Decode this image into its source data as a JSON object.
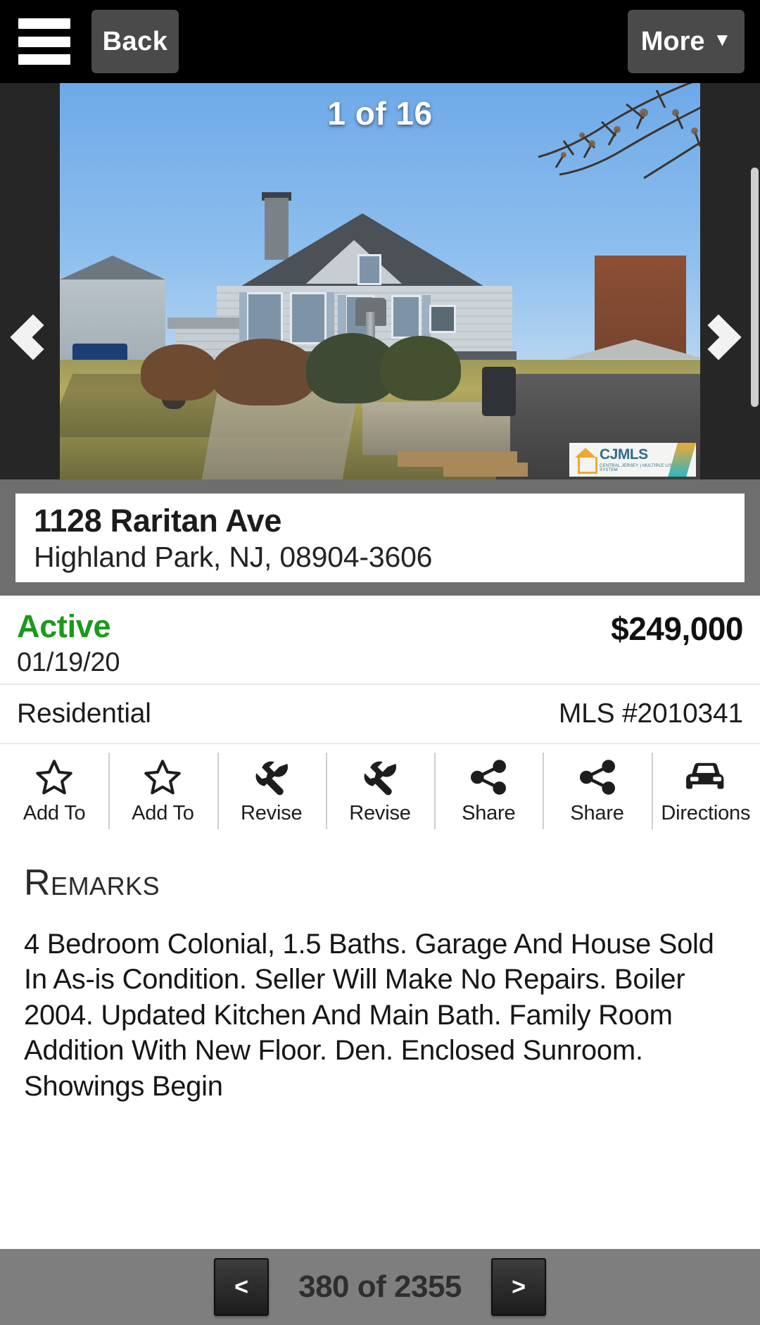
{
  "topbar": {
    "menu_icon": "hamburger-menu-icon",
    "back_label": "Back",
    "more_label": "More",
    "more_caret": "▼"
  },
  "gallery": {
    "counter": "1 of 16",
    "prev_icon": "chevron-left-icon",
    "next_icon": "chevron-right-icon",
    "watermark": {
      "main": "CJMLS",
      "sub": "CENTRAL JERSEY | MULTIPLE LISTING SYSTEM",
      "home_icon": "home-icon"
    }
  },
  "listing": {
    "address_line1": "1128 Raritan Ave",
    "address_line2": "Highland Park, NJ, 08904-3606",
    "status": "Active",
    "status_color": "#1a9a1a",
    "status_date": "01/19/20",
    "price": "$249,000",
    "property_type": "Residential",
    "mls": "MLS #2010341"
  },
  "actions": [
    {
      "label": "Add To",
      "icon": "star-outline-icon"
    },
    {
      "label": "Add To",
      "icon": "star-outline-icon"
    },
    {
      "label": "Revise",
      "icon": "wrench-icon"
    },
    {
      "label": "Revise",
      "icon": "wrench-icon"
    },
    {
      "label": "Share",
      "icon": "share-icon"
    },
    {
      "label": "Share",
      "icon": "share-icon"
    },
    {
      "label": "Directions",
      "icon": "car-icon"
    }
  ],
  "remarks": {
    "title": "Remarks",
    "body": "4 Bedroom Colonial, 1.5 Baths. Garage And House Sold In As-is Condition. Seller Will Make No Repairs. Boiler 2004. Updated Kitchen And Main Bath. Family Room Addition With New Floor. Den. Enclosed Sunroom. Showings Begin"
  },
  "pager": {
    "prev_label": "<",
    "next_label": ">",
    "position_label": "380 of 2355"
  }
}
